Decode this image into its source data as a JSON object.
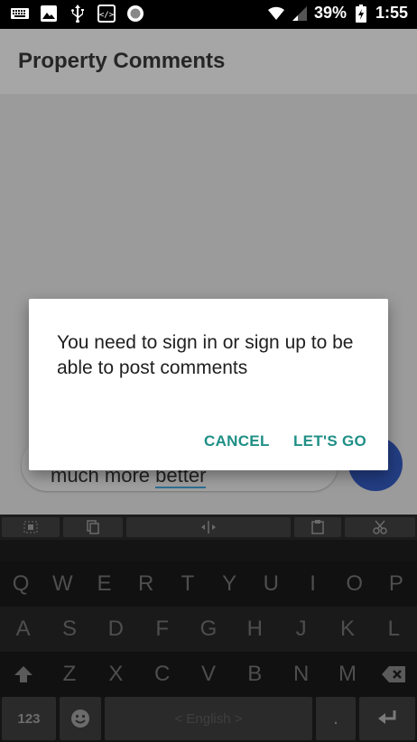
{
  "status_bar": {
    "battery_percent": "39%",
    "time": "1:55",
    "left_icons": [
      "keyboard-icon",
      "image-icon",
      "usb-icon",
      "code-icon",
      "record-icon"
    ],
    "right_icons": [
      "wifi-icon",
      "signal-icon",
      "battery-charging-icon"
    ]
  },
  "app_bar": {
    "title": "Property Comments"
  },
  "comment": {
    "text_before": "much more ",
    "text_underlined": "better"
  },
  "dialog": {
    "message": "You need to sign in or sign up to be able to post comments",
    "cancel_label": "CANCEL",
    "confirm_label": "LET'S GO",
    "accent_color": "#1f8f86"
  },
  "keyboard": {
    "row1": [
      "Q",
      "W",
      "E",
      "R",
      "T",
      "Y",
      "U",
      "I",
      "O",
      "P"
    ],
    "row2": [
      "A",
      "S",
      "D",
      "F",
      "G",
      "H",
      "J",
      "K",
      "L"
    ],
    "row3": [
      "Z",
      "X",
      "C",
      "V",
      "B",
      "N",
      "M"
    ],
    "numbers_label": "123",
    "space_label": "< English >",
    "period_label": ".",
    "toolbar_icons": [
      "select-all-icon",
      "copy-icon",
      "cursor-icon",
      "paste-icon",
      "cut-icon"
    ]
  }
}
